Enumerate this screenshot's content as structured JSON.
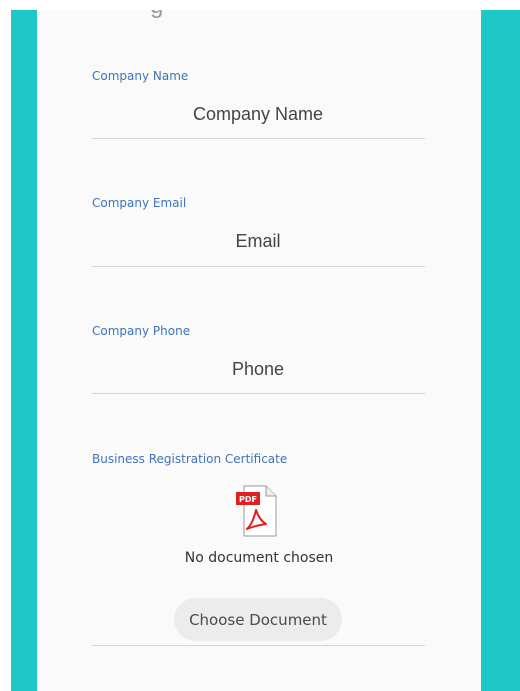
{
  "colors": {
    "side_bars": "#1ec8c6",
    "label": "#3f74b8",
    "underline": "#d3d3d3",
    "button_bg": "#ececec"
  },
  "form": {
    "company_name": {
      "label": "Company Name",
      "placeholder": "Company Name",
      "value": ""
    },
    "company_email": {
      "label": "Company Email",
      "placeholder": "Email",
      "value": ""
    },
    "company_phone": {
      "label": "Company Phone",
      "placeholder": "Phone",
      "value": ""
    },
    "registration_certificate": {
      "label": "Business Registration Certificate",
      "icon": "pdf-icon",
      "status": "No document chosen",
      "button_label": "Choose Document"
    }
  }
}
